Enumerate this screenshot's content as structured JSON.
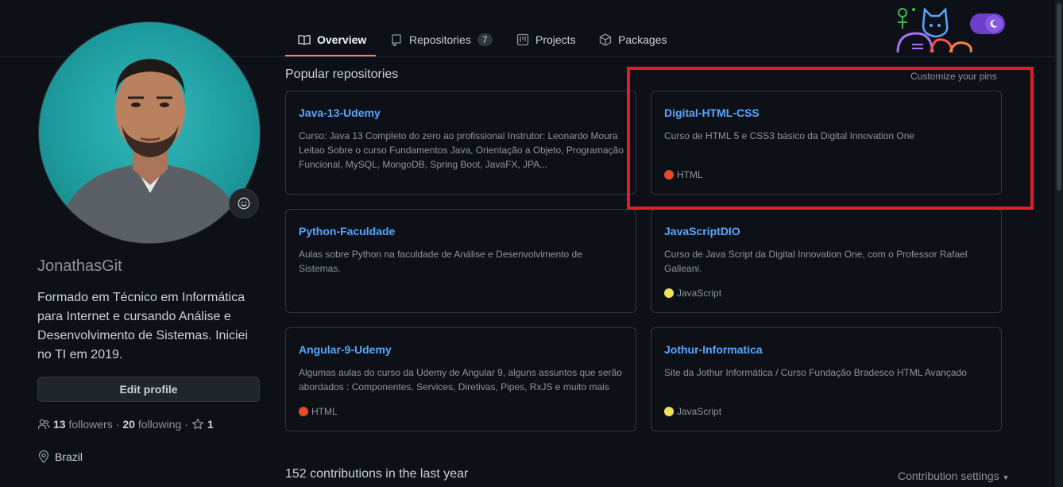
{
  "nav": {
    "tabs": [
      {
        "label": "Overview",
        "icon": "book-icon",
        "active": true
      },
      {
        "label": "Repositories",
        "icon": "repo-icon",
        "count": "7"
      },
      {
        "label": "Projects",
        "icon": "project-icon"
      },
      {
        "label": "Packages",
        "icon": "package-icon"
      }
    ]
  },
  "profile": {
    "username": "JonathasGit",
    "bio": "Formado em Técnico em Informática para Internet e cursando Análise e Desenvolvimento de Sistemas. Iniciei no TI em 2019.",
    "edit_label": "Edit profile",
    "followers_count": "13",
    "followers_label": "followers",
    "following_count": "20",
    "following_label": "following",
    "stars_count": "1",
    "location": "Brazil"
  },
  "popular": {
    "title": "Popular repositories",
    "customize_label": "Customize your pins",
    "repos": [
      {
        "name": "Java-13-Udemy",
        "desc": "Curso: Java 13 Completo do zero ao profissional Instrutor: Leonardo Moura Leitao Sobre o curso Fundamentos Java, Orientação a Objeto, Programação Funcional, MySQL, MongoDB, Spring Boot, JavaFX, JPA...",
        "lang": "",
        "lang_color": ""
      },
      {
        "name": "Digital-HTML-CSS",
        "desc": "Curso de HTML 5 e CSS3 básico da Digital Innovation One",
        "lang": "HTML",
        "lang_color": "#e34c26"
      },
      {
        "name": "Python-Faculdade",
        "desc": "Aulas sobre Python na faculdade de Análise e Desenvolvimento de Sistemas.",
        "lang": "",
        "lang_color": ""
      },
      {
        "name": "JavaScriptDIO",
        "desc": "Curso de Java Script da Digital Innovation One, com o Professor Rafael Galleani.",
        "lang": "JavaScript",
        "lang_color": "#f1e05a"
      },
      {
        "name": "Angular-9-Udemy",
        "desc": "Algumas aulas do curso da Udemy de Angular 9, alguns assuntos que serão abordados : Componentes, Services, Diretivas, Pipes, RxJS e muito mais",
        "lang": "HTML",
        "lang_color": "#e34c26"
      },
      {
        "name": "Jothur-Informatica",
        "desc": "Site da Jothur Informática / Curso Fundação Bradesco HTML Avançado",
        "lang": "JavaScript",
        "lang_color": "#f1e05a"
      }
    ]
  },
  "contributions": {
    "summary": "152 contributions in the last year",
    "settings_label": "Contribution settings"
  },
  "colors": {
    "accent": "#58a6ff",
    "highlight_box": "#e11d2a",
    "tab_underline": "#f78166"
  }
}
